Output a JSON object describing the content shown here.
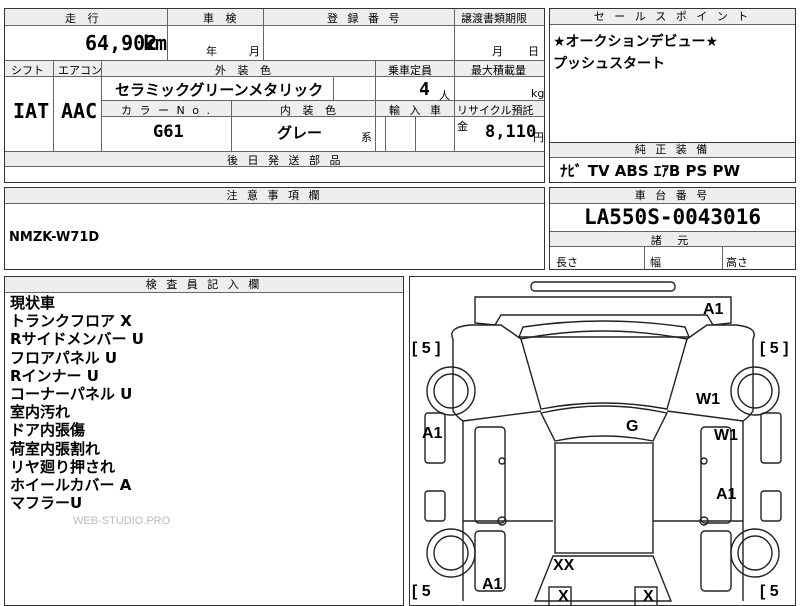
{
  "spec": {
    "mileage_header": "走 行",
    "mileage_value": "64,902",
    "mileage_unit": "km",
    "inspection_header": "車 検",
    "inspection_year": "年",
    "inspection_month": "月",
    "registration_header": "登 録 番 号",
    "transfer_header": "譲渡書類期限",
    "transfer_month": "月",
    "transfer_day": "日",
    "shift_header": "シフト",
    "aircon_header": "エアコン",
    "exterior_header": "外 装 色",
    "capacity_header": "乗車定員",
    "load_header": "最大積載量",
    "shift_value": "IAT",
    "aircon_value": "AAC",
    "exterior_value": "セラミックグリーンメタリック",
    "capacity_value": "4",
    "capacity_unit": "人",
    "load_unit": "kg",
    "color_no_header": "カ ラ ー N o .",
    "interior_header": "内 装 色",
    "import_header": "輸 入 車",
    "recycle_header": "リサイクル預託金",
    "color_no_value": "G61",
    "interior_value": "グレー",
    "interior_suffix": "系",
    "recycle_value": "8,110",
    "recycle_unit": "円",
    "parts_header": "後 日 発 送 部 品"
  },
  "sales": {
    "header": "セ ー ル ス ポ イ ン ト",
    "line1": "★オークションデビュー★",
    "line2": "プッシュスタート"
  },
  "equipment": {
    "header": "純 正 装 備",
    "value": "ﾅﾋﾞ TV ABS ｴｱB PS PW"
  },
  "caution": {
    "header": "注 意 事 項 欄",
    "value": "NMZK-W71D"
  },
  "chassis": {
    "header": "車 台 番 号",
    "value": "LA550S-0043016"
  },
  "dimensions": {
    "header": "諸 元",
    "length": "長さ",
    "width": "幅",
    "height": "高さ"
  },
  "inspector": {
    "header": "検 査 員 記 入 欄",
    "notes": [
      "現状車",
      "トランクフロア X",
      "Rサイドメンバー U",
      "フロアパネル U",
      "Rインナー U",
      "コーナーパネル U",
      "室内汚れ",
      "ドア内張傷",
      "荷室内張割れ",
      "リヤ廻り押され",
      "ホイールカバー A",
      "マフラーU"
    ],
    "watermark": "WEB-STUDIO.PRO"
  },
  "diagram": {
    "tire_front_left": "[ 5 ]",
    "tire_front_right": "[ 5 ]",
    "tire_rear_left": "[ 5",
    "tire_rear_right": "[ 5",
    "marks": {
      "front_bumper": "A1",
      "front_right_fender": "W1",
      "roof": "G",
      "left_front_door": "A1",
      "right_front_door": "W1",
      "right_rear_door": "A1",
      "rear_left": "A1",
      "rear_floor": "XX",
      "rear_left_x": "X",
      "rear_right_x": "X"
    }
  }
}
